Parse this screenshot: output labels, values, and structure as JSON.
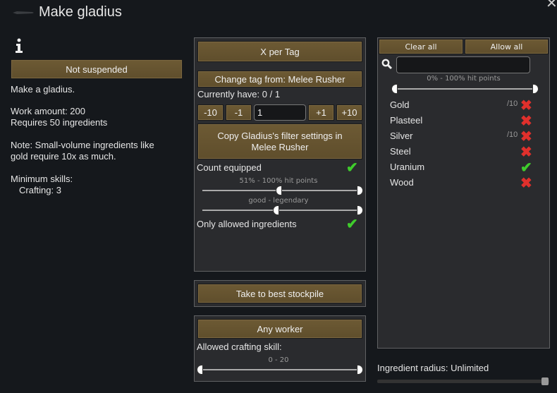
{
  "title": "Make gladius",
  "left": {
    "suspend_button": "Not suspended",
    "description": "Make a gladius.",
    "work_amount": "Work amount: 200",
    "requires": "Requires 50 ingredients",
    "note1": "Note: Small-volume ingredients like",
    "note2": "gold require 10x as much.",
    "min_skills": "Minimum skills:",
    "crafting": "Crafting: 3"
  },
  "middle": {
    "mode_button": "X per Tag",
    "change_tag_button": "Change tag from: Melee Rusher",
    "currently_have": "Currently have: 0 / 1",
    "stepper": {
      "minus10": "-10",
      "minus1": "-1",
      "value": "1",
      "plus1": "+1",
      "plus10": "+10"
    },
    "copy_button": "Copy Gladius's filter settings in Melee Rusher",
    "count_equipped": "Count equipped",
    "count_equipped_checked": true,
    "hit_points_range": "51% - 100% hit points",
    "quality_range": "good - legendary",
    "only_allowed": "Only allowed ingredients",
    "only_allowed_checked": true,
    "stockpile_button": "Take to best stockpile",
    "worker_button": "Any worker",
    "allowed_skill": "Allowed crafting skill:",
    "skill_range": "0 - 20"
  },
  "right": {
    "clear_all": "Clear all",
    "allow_all": "Allow all",
    "search_value": "",
    "hit_points_range": "0% - 100% hit points",
    "items": [
      {
        "name": "Gold",
        "note": "/10",
        "allowed": false
      },
      {
        "name": "Plasteel",
        "note": "",
        "allowed": false
      },
      {
        "name": "Silver",
        "note": "/10",
        "allowed": false
      },
      {
        "name": "Steel",
        "note": "",
        "allowed": false
      },
      {
        "name": "Uranium",
        "note": "",
        "allowed": true
      },
      {
        "name": "Wood",
        "note": "",
        "allowed": false
      }
    ]
  },
  "ingredient_radius": "Ingredient radius: Unlimited",
  "colors": {
    "button": "#6d5a34",
    "check": "#3fcc2c",
    "cross": "#e0302c"
  }
}
